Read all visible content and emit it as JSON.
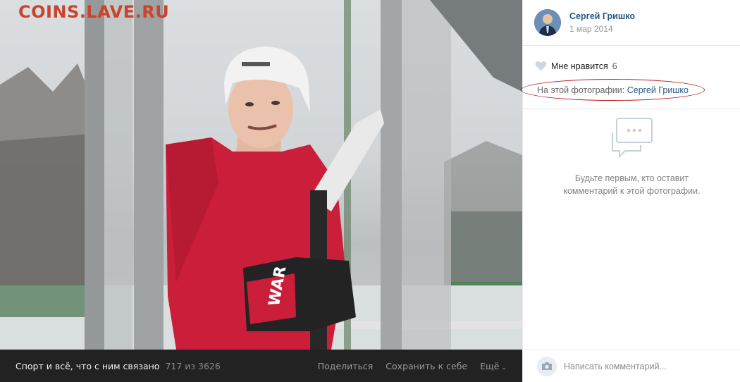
{
  "watermark": "COINS.LAVE.RU",
  "photo": {
    "album_title": "Спорт и всё, что с ним связано",
    "counter": "717 из 3626",
    "actions": {
      "share": "Поделиться",
      "save": "Сохранить к себе",
      "more": "Ещё"
    }
  },
  "author": {
    "name": "Сергей Гришко",
    "date": "1 мар 2014"
  },
  "likes": {
    "label": "Мне нравится",
    "count": "6"
  },
  "tagged": {
    "label": "На этой фотографии:",
    "person": "Сергей Гришко"
  },
  "comments": {
    "empty_line1": "Будьте первым, кто оставит",
    "empty_line2": "комментарий к этой фотографии.",
    "placeholder": "Написать комментарий..."
  },
  "colors": {
    "link": "#2a5885",
    "annotation": "#c01d1d",
    "bar": "#222222",
    "jersey": "#c8102e"
  }
}
